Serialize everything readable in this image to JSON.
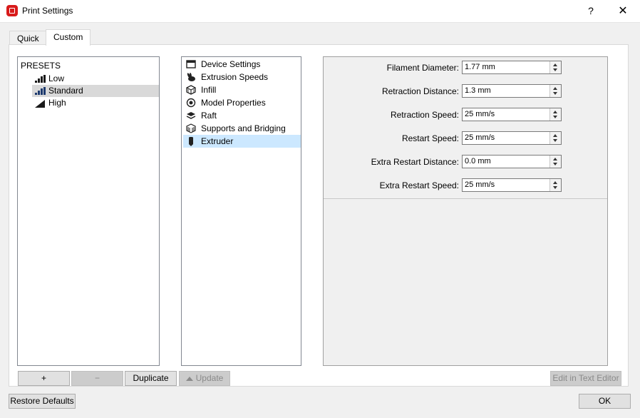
{
  "window": {
    "title": "Print Settings",
    "help_label": "?",
    "close_label": "✕"
  },
  "tabs": [
    {
      "label": "Quick"
    },
    {
      "label": "Custom",
      "active": true
    }
  ],
  "presets": {
    "header": "PRESETS",
    "items": [
      {
        "label": "Low",
        "icon": "signal-low-icon"
      },
      {
        "label": "Standard",
        "icon": "signal-medium-icon",
        "selected": true
      },
      {
        "label": "High",
        "icon": "signal-high-icon"
      }
    ]
  },
  "categories": [
    {
      "label": "Device Settings",
      "icon": "window-icon"
    },
    {
      "label": "Extrusion Speeds",
      "icon": "rabbit-icon"
    },
    {
      "label": "Infill",
      "icon": "cube-icon"
    },
    {
      "label": "Model Properties",
      "icon": "gear-circle-icon"
    },
    {
      "label": "Raft",
      "icon": "layers-icon"
    },
    {
      "label": "Supports and Bridging",
      "icon": "supports-icon"
    },
    {
      "label": "Extruder",
      "icon": "extruder-icon",
      "selected": true
    }
  ],
  "settings": [
    {
      "label": "Filament Diameter:",
      "value": "1.77 mm"
    },
    {
      "label": "Retraction Distance:",
      "value": "1.3 mm"
    },
    {
      "label": "Retraction Speed:",
      "value": "25 mm/s"
    },
    {
      "label": "Restart Speed:",
      "value": "25 mm/s"
    },
    {
      "label": "Extra Restart Distance:",
      "value": "0.0 mm"
    },
    {
      "label": "Extra Restart Speed:",
      "value": "25 mm/s"
    }
  ],
  "buttons": {
    "add": "+",
    "remove": "−",
    "duplicate": "Duplicate",
    "update": "Update",
    "edit_text": "Edit in Text Editor",
    "restore": "Restore Defaults",
    "ok": "OK"
  },
  "colors": {
    "selection_blue": "#cce8ff",
    "app_red": "#d81b1b"
  }
}
